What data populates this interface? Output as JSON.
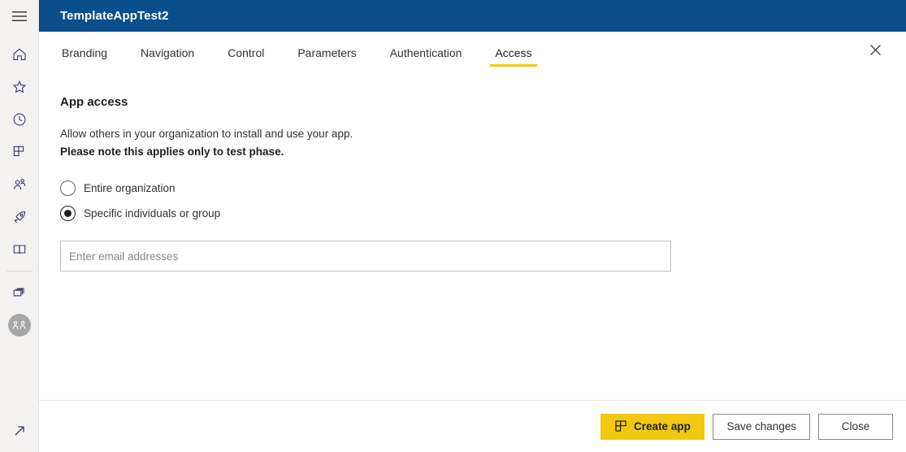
{
  "rail": {
    "items": [
      {
        "name": "hamburger-menu",
        "icon": "hamburger-icon",
        "label": "Navigation menu"
      },
      {
        "name": "home",
        "icon": "home-icon",
        "label": "Home"
      },
      {
        "name": "favorites",
        "icon": "star-icon",
        "label": "Favorites"
      },
      {
        "name": "recent",
        "icon": "clock-icon",
        "label": "Recent"
      },
      {
        "name": "apps",
        "icon": "grid-apps-icon",
        "label": "Apps"
      },
      {
        "name": "shared-with-me",
        "icon": "people-icon",
        "label": "Shared with me"
      },
      {
        "name": "deployment-pipelines",
        "icon": "rocket-icon",
        "label": "Deployment pipelines"
      },
      {
        "name": "learn",
        "icon": "book-icon",
        "label": "Learn"
      },
      {
        "name": "workspaces",
        "icon": "stacked-windows-icon",
        "label": "Workspaces"
      },
      {
        "name": "current-workspace-avatar",
        "icon": "group-avatar-icon",
        "label": "Workspace"
      }
    ],
    "bottom": {
      "name": "expand-rail",
      "icon": "arrow-up-right-icon",
      "label": "Expand"
    }
  },
  "header": {
    "title": "TemplateAppTest2",
    "background_color": "#0a4f8c",
    "close_icon": "close-icon"
  },
  "tabs": {
    "items": [
      {
        "label": "Branding",
        "active": false
      },
      {
        "label": "Navigation",
        "active": false
      },
      {
        "label": "Control",
        "active": false
      },
      {
        "label": "Parameters",
        "active": false
      },
      {
        "label": "Authentication",
        "active": false
      },
      {
        "label": "Access",
        "active": true
      }
    ],
    "active_underline_color": "#f2c811"
  },
  "main": {
    "section_title": "App access",
    "description_line_1": "Allow others in your organization to install and use your app.",
    "description_line_2": "Please note this applies only to test phase.",
    "radio_options": [
      {
        "label": "Entire organization",
        "selected": false
      },
      {
        "label": "Specific individuals or group",
        "selected": true
      }
    ],
    "email_input": {
      "value": "",
      "placeholder": "Enter email addresses"
    }
  },
  "footer": {
    "create_app_label": "Create app",
    "create_app_icon": "grid-apps-icon",
    "save_changes_label": "Save changes",
    "close_label": "Close",
    "primary_color": "#f2c811"
  }
}
